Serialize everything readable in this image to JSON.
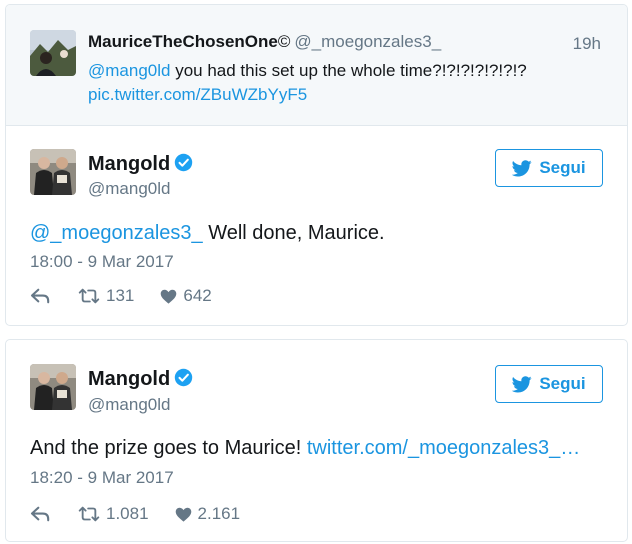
{
  "parent_tweet": {
    "display_name": "MauriceTheChosenOne",
    "name_symbol": "©",
    "handle": "@_moegonzales3_",
    "time": "19h",
    "mention": "@mang0ld",
    "text": " you had this set up the whole time?!?!?!?!?!?!?",
    "link": "pic.twitter.com/ZBuWZbYyF5"
  },
  "tweets": [
    {
      "display_name": "Mangold",
      "handle": "@mang0ld",
      "follow_label": "Segui",
      "mention": "@_moegonzales3_",
      "text": " Well done, Maurice.",
      "timestamp": "18:00 - 9 Mar 2017",
      "retweets": "131",
      "likes": "642"
    },
    {
      "display_name": "Mangold",
      "handle": "@mang0ld",
      "follow_label": "Segui",
      "text": "And the prize goes to Maurice! ",
      "link": "twitter.com/_moegonzales3_…",
      "timestamp": "18:20 - 9 Mar 2017",
      "retweets": "1.081",
      "likes": "2.161"
    }
  ],
  "colors": {
    "accent": "#1b95e0",
    "muted": "#657786",
    "verified": "#1da1f2",
    "border": "#e1e8ed",
    "parent_bg": "#f5f8fa"
  }
}
